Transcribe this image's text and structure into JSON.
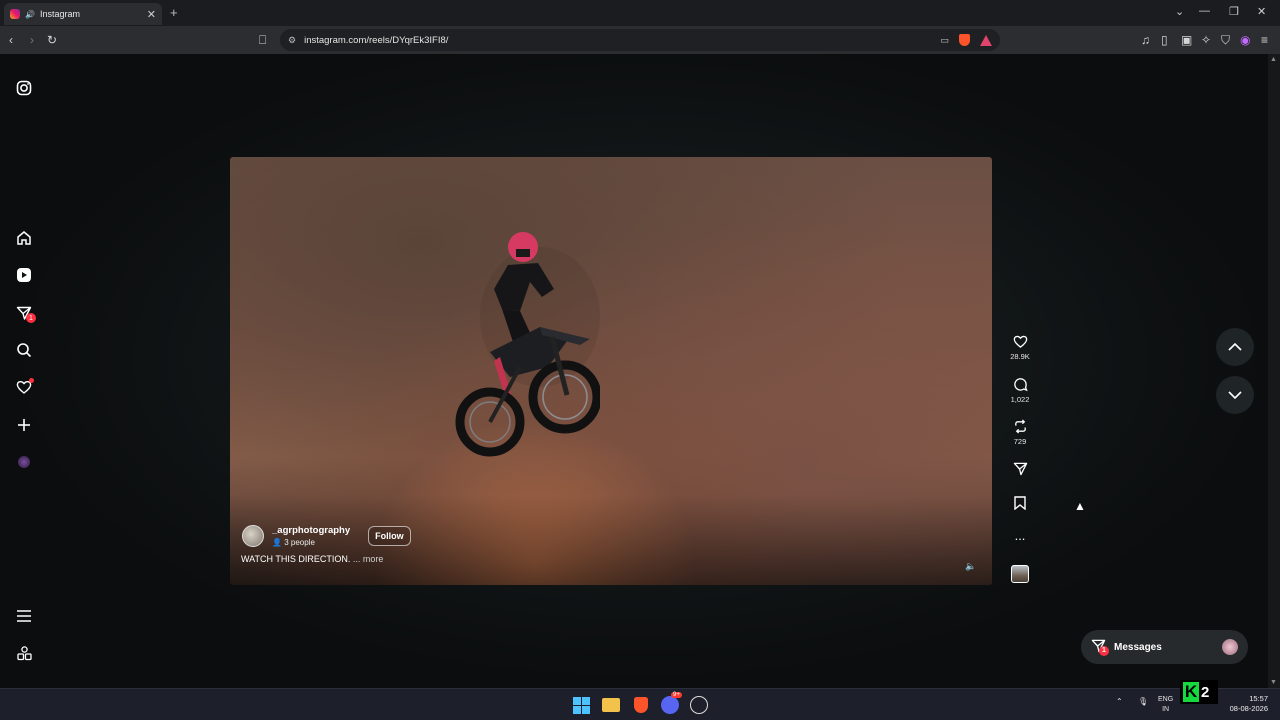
{
  "browser": {
    "tab_title": "Instagram",
    "new_tab": "+",
    "url": "instagram.com/reels/DYqrEk3IFI8/"
  },
  "sidebar": {
    "notifications_badge": "1"
  },
  "reel": {
    "author": "_agrphotography",
    "collab": "3 people",
    "follow_label": "Follow",
    "caption": "WATCH THIS DIRECTION.",
    "caption_more": "... more"
  },
  "actions": {
    "likes": "28.9K",
    "comments": "1,022",
    "reposts": "729",
    "more": "..."
  },
  "messages": {
    "label": "Messages",
    "badge": "1"
  },
  "taskbar": {
    "discord_badge": "9+",
    "lang_top": "ENG",
    "lang_bottom": "IN",
    "time": "15:57",
    "date": "08-08-2026",
    "overlay_badge": "2"
  }
}
